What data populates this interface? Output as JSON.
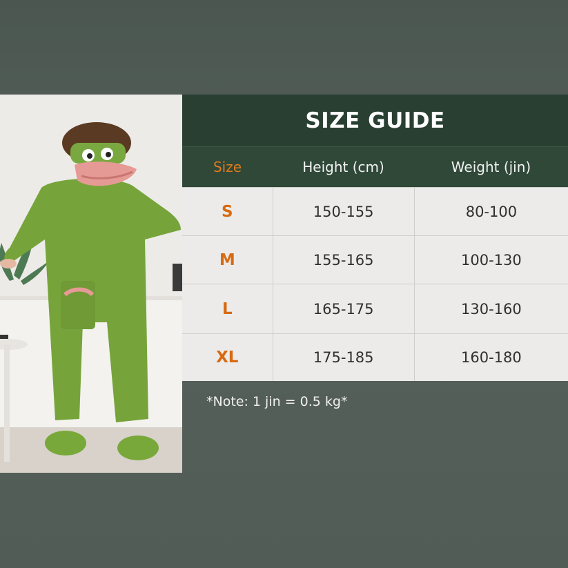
{
  "guide": {
    "title": "SIZE GUIDE",
    "headers": [
      "Size",
      "Height (cm)",
      "Weight (jin)"
    ],
    "rows": [
      {
        "size": "S",
        "height": "150-155",
        "weight": "80-100"
      },
      {
        "size": "M",
        "height": "155-165",
        "weight": "100-130"
      },
      {
        "size": "L",
        "height": "165-175",
        "weight": "130-160"
      },
      {
        "size": "XL",
        "height": "175-185",
        "weight": "160-180"
      }
    ],
    "note": "*Note: 1 jin = 0.5 kg*"
  },
  "colors": {
    "title_bg": "#283f32",
    "header_bg": "#2f4838",
    "size_accent": "#e07a1e",
    "costume_green": "#76a43a"
  },
  "photo": {
    "icon": "frog-costume-photo"
  }
}
